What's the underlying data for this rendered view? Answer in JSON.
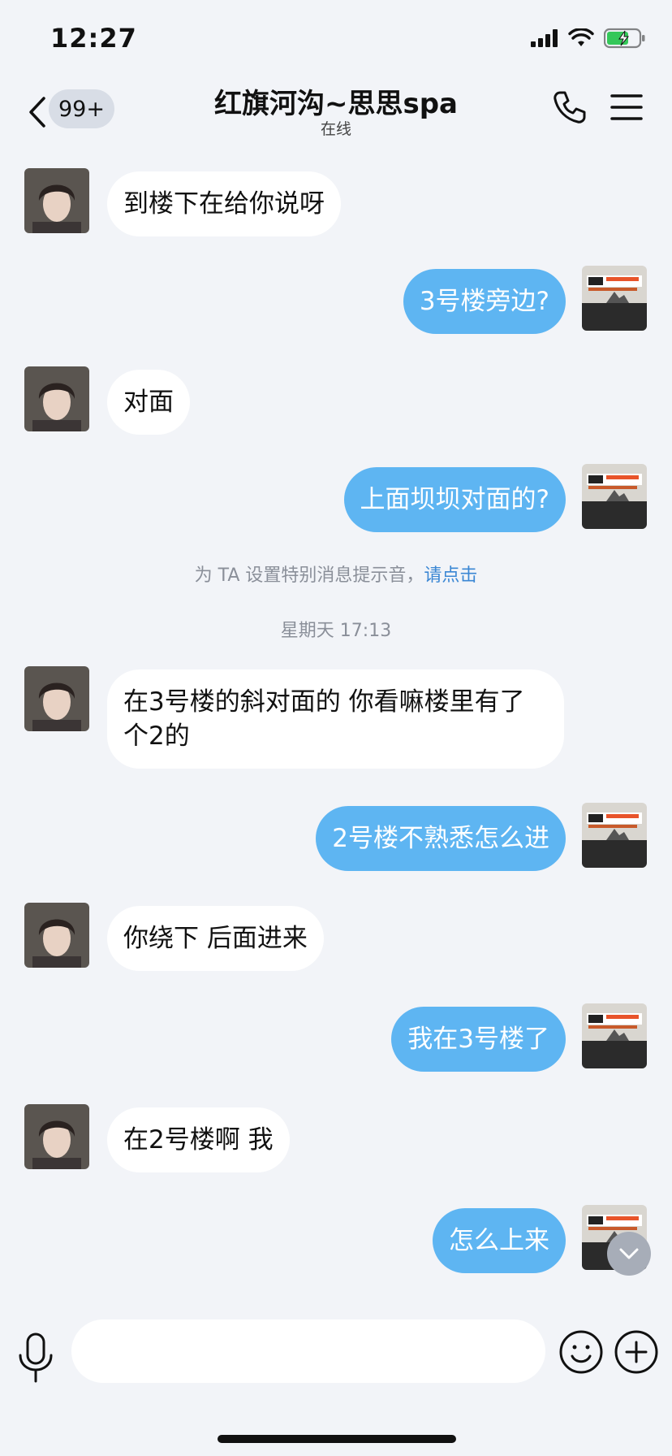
{
  "status_bar": {
    "time": "12:27",
    "icons": [
      "signal-icon",
      "wifi-icon",
      "battery-charging-icon"
    ]
  },
  "header": {
    "back_icon": "chevron-left-icon",
    "unread_count": "99+",
    "title": "红旗河沟~思思spa",
    "subtitle": "在线",
    "call_icon": "phone-icon",
    "menu_icon": "menu-icon"
  },
  "messages": [
    {
      "side": "in",
      "text": "到楼下在给你说呀"
    },
    {
      "side": "out",
      "text": "3号楼旁边?"
    },
    {
      "side": "in",
      "text": "对面"
    },
    {
      "side": "out",
      "text": "上面坝坝对面的?"
    },
    {
      "side": "in",
      "text": "在3号楼的斜对面的 你看嘛楼里有了个2的"
    },
    {
      "side": "out",
      "text": "2号楼不熟悉怎么进"
    },
    {
      "side": "in",
      "text": "你绕下 后面进来"
    },
    {
      "side": "out",
      "text": "我在3号楼了"
    },
    {
      "side": "in",
      "text": "在2号楼啊 我"
    },
    {
      "side": "out",
      "text": "怎么上来"
    }
  ],
  "system_notice": {
    "text": "为 TA 设置特别消息提示音，",
    "link": "请点击"
  },
  "timestamp": "星期天 17:13",
  "input": {
    "placeholder": "",
    "value": "",
    "mic_icon": "microphone-icon",
    "emoji_icon": "smiley-icon",
    "plus_icon": "plus-circle-icon"
  },
  "colors": {
    "background": "#f2f4f8",
    "outgoing_bubble": "#5eb5f2",
    "incoming_bubble": "#ffffff",
    "link": "#3b87d4"
  }
}
